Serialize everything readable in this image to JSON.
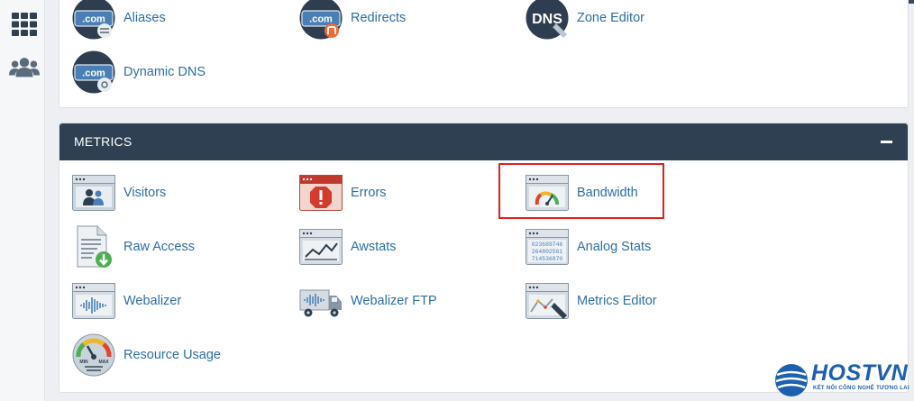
{
  "rail": {
    "items": [
      {
        "icon": "grid-icon"
      },
      {
        "icon": "users-icon"
      }
    ]
  },
  "domains_panel": {
    "items": [
      {
        "label": "Aliases",
        "icon": "domain-aliases-icon"
      },
      {
        "label": "Redirects",
        "icon": "domain-redirects-icon"
      },
      {
        "label": "Zone Editor",
        "icon": "dns-zone-editor-icon"
      },
      {
        "label": "Dynamic DNS",
        "icon": "dynamic-dns-icon"
      }
    ]
  },
  "metrics_panel": {
    "title": "METRICS",
    "items": [
      {
        "label": "Visitors",
        "icon": "visitors-icon"
      },
      {
        "label": "Errors",
        "icon": "errors-icon"
      },
      {
        "label": "Bandwidth",
        "icon": "bandwidth-gauge-icon"
      },
      {
        "label": "Raw Access",
        "icon": "raw-access-icon"
      },
      {
        "label": "Awstats",
        "icon": "awstats-chart-icon"
      },
      {
        "label": "Analog Stats",
        "icon": "analog-stats-icon"
      },
      {
        "label": "Webalizer",
        "icon": "webalizer-icon"
      },
      {
        "label": "Webalizer FTP",
        "icon": "webalizer-ftp-truck-icon"
      },
      {
        "label": "Metrics Editor",
        "icon": "metrics-editor-icon"
      },
      {
        "label": "Resource Usage",
        "icon": "resource-usage-gauge-icon"
      }
    ],
    "analog_numbers": [
      "023689746",
      "264802561",
      "714536870"
    ],
    "gauge_labels": {
      "min": "MIN",
      "max": "MAX"
    }
  },
  "brand": {
    "name": "HOSTVN",
    "tagline": "KẾT NỐI CÔNG NGHỆ TƯƠNG LAI"
  },
  "colors": {
    "link": "#2c6ea6",
    "header": "#2f4052",
    "highlight": "#e02020",
    "brand": "#1d5fb0"
  }
}
